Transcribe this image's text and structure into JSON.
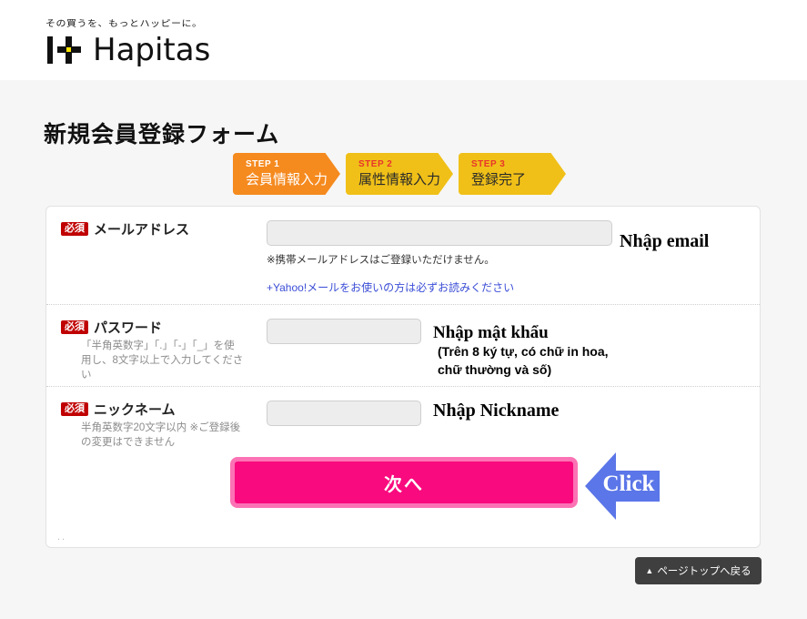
{
  "header": {
    "tagline": "その買うを、もっとハッピーに。",
    "logo_word": "Hapitas",
    "logo_icon": "hapitas-plus-mark"
  },
  "page_title": "新規会員登録フォーム",
  "steps": [
    {
      "num": "STEP 1",
      "label": "会員情報入力",
      "state": "active"
    },
    {
      "num": "STEP 2",
      "label": "属性情報入力",
      "state": "idle"
    },
    {
      "num": "STEP 3",
      "label": "登録完了",
      "state": "idle"
    }
  ],
  "form": {
    "required_badge": "必須",
    "email": {
      "label": "メールアドレス",
      "value": "",
      "placeholder": "",
      "note": "※携帯メールアドレスはご登録いただけません。",
      "link": "+Yahoo!メールをお使いの方は必ずお読みください",
      "annotation": "Nhập email"
    },
    "password": {
      "label": "パスワード",
      "hint": "「半角英数字」「.」「-」「_」を使用し、8文字以上で入力してください",
      "value": "",
      "placeholder": "",
      "annotation": "Nhập mật khẩu",
      "annotation_sub": "(Trên 8 ký tự, có chữ in hoa, chữ thường và số)"
    },
    "nickname": {
      "label": "ニックネーム",
      "hint": "半角英数字20文字以内 ※ご登録後の変更はできません",
      "value": "",
      "placeholder": "",
      "annotation": "Nhập Nickname"
    },
    "submit_label": "次へ",
    "footer_dots": ".."
  },
  "callout": {
    "arrow_label": "Click",
    "arrow_direction": "left"
  },
  "back_to_top": {
    "triangle": "▲",
    "label": "ページトップへ戻る"
  },
  "colors": {
    "step_active": "#f58a1f",
    "step_idle": "#f0c018",
    "step_num_idle": "#e8352b",
    "required_badge": "#c00000",
    "submit_fill": "#f90a7e",
    "submit_border": "#fb73b4",
    "link": "#3b4ed6",
    "arrow": "#5b76e8",
    "back_to_top": "#3f3f3f",
    "logo_accent": "#ffe500"
  }
}
